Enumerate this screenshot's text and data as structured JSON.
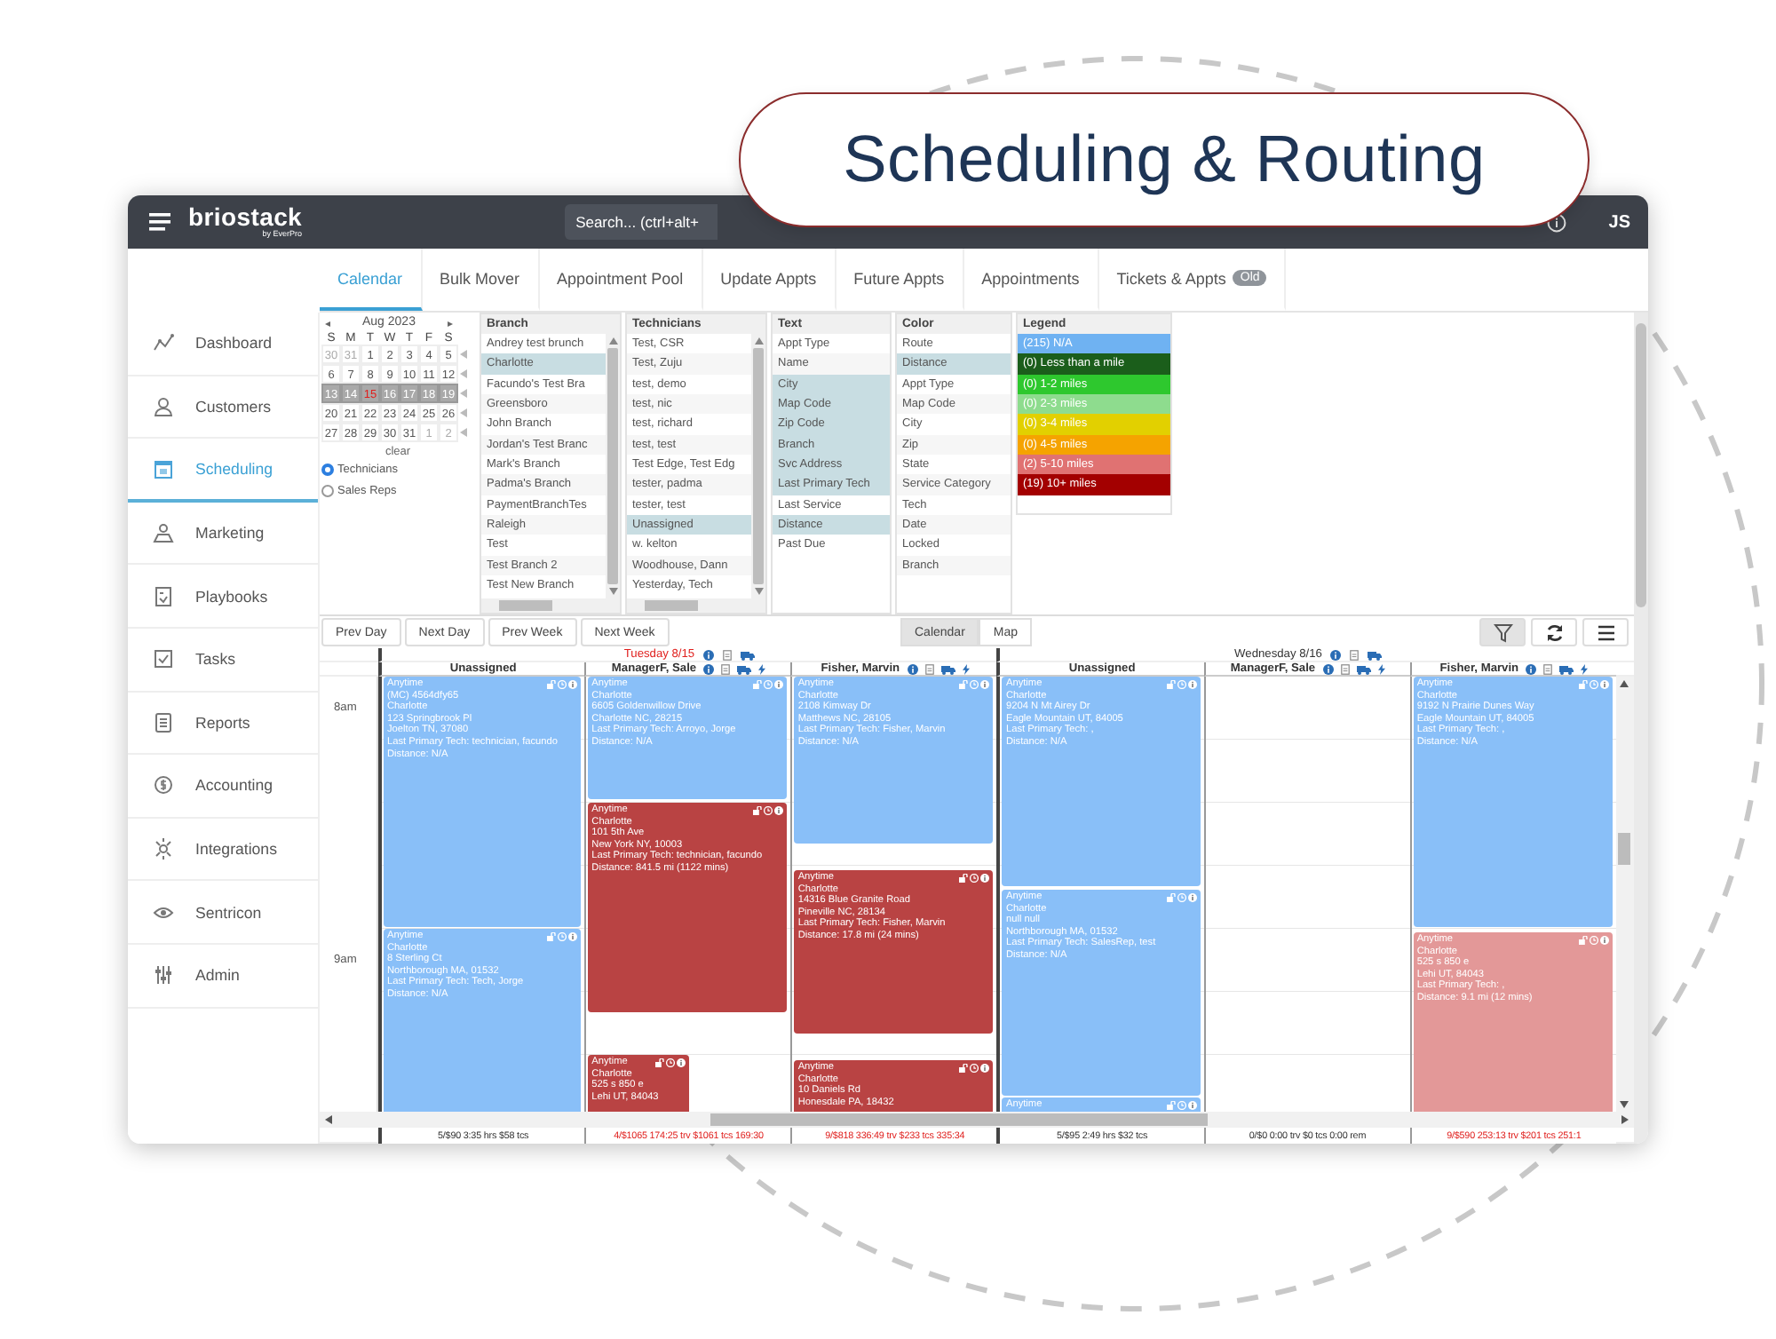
{
  "promo_title": "Scheduling & Routing",
  "header": {
    "logo": "briostack",
    "logo_sub": "by EverPro",
    "search": {
      "placeholder": "Search... (ctrl+alt+"
    },
    "user": "JS"
  },
  "tabs": [
    {
      "label": "Calendar",
      "selected": true
    },
    {
      "label": "Bulk Mover",
      "selected": false
    },
    {
      "label": "Appointment Pool",
      "selected": false
    },
    {
      "label": "Update Appts",
      "selected": false
    },
    {
      "label": "Future Appts",
      "selected": false
    },
    {
      "label": "Appointments",
      "selected": false
    },
    {
      "label": "Tickets & Appts",
      "selected": false,
      "badge": "Old"
    }
  ],
  "sidebar": {
    "items": [
      {
        "label": "Dashboard",
        "selected": false
      },
      {
        "label": "Customers",
        "selected": false
      },
      {
        "label": "Scheduling",
        "selected": true
      },
      {
        "label": "Marketing",
        "selected": false
      },
      {
        "label": "Playbooks",
        "selected": false
      },
      {
        "label": "Tasks",
        "selected": false
      },
      {
        "label": "Reports",
        "selected": false
      },
      {
        "label": "Accounting",
        "selected": false
      },
      {
        "label": "Integrations",
        "selected": false
      },
      {
        "label": "Sentricon",
        "selected": false
      },
      {
        "label": "Admin",
        "selected": false
      }
    ]
  },
  "mini_calendar": {
    "prev": "◂",
    "month": "Aug 2023",
    "next": "▸",
    "weekdays": [
      "S",
      "M",
      "T",
      "W",
      "T",
      "F",
      "S"
    ],
    "clear": "clear",
    "weeks": [
      {
        "selected": false,
        "days": [
          {
            "day": "30",
            "other_month": true,
            "today": false
          },
          {
            "day": "31",
            "other_month": true,
            "today": false
          },
          {
            "day": "1",
            "other_month": false,
            "today": false
          },
          {
            "day": "2",
            "other_month": false,
            "today": false
          },
          {
            "day": "3",
            "other_month": false,
            "today": false
          },
          {
            "day": "4",
            "other_month": false,
            "today": false
          },
          {
            "day": "5",
            "other_month": false,
            "today": false
          }
        ]
      },
      {
        "selected": false,
        "days": [
          {
            "day": "6",
            "other_month": false,
            "today": false
          },
          {
            "day": "7",
            "other_month": false,
            "today": false
          },
          {
            "day": "8",
            "other_month": false,
            "today": false
          },
          {
            "day": "9",
            "other_month": false,
            "today": false
          },
          {
            "day": "10",
            "other_month": false,
            "today": false
          },
          {
            "day": "11",
            "other_month": false,
            "today": false
          },
          {
            "day": "12",
            "other_month": false,
            "today": false
          }
        ]
      },
      {
        "selected": true,
        "days": [
          {
            "day": "13",
            "other_month": false,
            "today": false
          },
          {
            "day": "14",
            "other_month": false,
            "today": false
          },
          {
            "day": "15",
            "other_month": false,
            "today": true
          },
          {
            "day": "16",
            "other_month": false,
            "today": false
          },
          {
            "day": "17",
            "other_month": false,
            "today": false
          },
          {
            "day": "18",
            "other_month": false,
            "today": false
          },
          {
            "day": "19",
            "other_month": false,
            "today": false
          }
        ]
      },
      {
        "selected": false,
        "days": [
          {
            "day": "20",
            "other_month": false,
            "today": false
          },
          {
            "day": "21",
            "other_month": false,
            "today": false
          },
          {
            "day": "22",
            "other_month": false,
            "today": false
          },
          {
            "day": "23",
            "other_month": false,
            "today": false
          },
          {
            "day": "24",
            "other_month": false,
            "today": false
          },
          {
            "day": "25",
            "other_month": false,
            "today": false
          },
          {
            "day": "26",
            "other_month": false,
            "today": false
          }
        ]
      },
      {
        "selected": false,
        "days": [
          {
            "day": "27",
            "other_month": false,
            "today": false
          },
          {
            "day": "28",
            "other_month": false,
            "today": false
          },
          {
            "day": "29",
            "other_month": false,
            "today": false
          },
          {
            "day": "30",
            "other_month": false,
            "today": false
          },
          {
            "day": "31",
            "other_month": false,
            "today": false
          },
          {
            "day": "1",
            "other_month": true,
            "today": false
          },
          {
            "day": "2",
            "other_month": true,
            "today": false
          }
        ]
      }
    ]
  },
  "view_radios": [
    {
      "label": "Technicians",
      "selected": true
    },
    {
      "label": "Sales Reps",
      "selected": false
    }
  ],
  "filters": [
    {
      "title": "Branch",
      "kind": "scrolling",
      "items": [
        {
          "label": "Andrey test brunch",
          "selected": false
        },
        {
          "label": "Charlotte",
          "selected": true
        },
        {
          "label": "Facundo's Test Bra",
          "selected": false
        },
        {
          "label": "Greensboro",
          "selected": false
        },
        {
          "label": "John Branch",
          "selected": false
        },
        {
          "label": "Jordan's Test Branc",
          "selected": false
        },
        {
          "label": "Mark's Branch",
          "selected": false
        },
        {
          "label": "Padma's Branch",
          "selected": false
        },
        {
          "label": "PaymentBranchTes",
          "selected": false
        },
        {
          "label": "Raleigh",
          "selected": false
        },
        {
          "label": "Test",
          "selected": false
        },
        {
          "label": "Test Branch 2",
          "selected": false
        },
        {
          "label": "Test New Branch",
          "selected": false
        }
      ]
    },
    {
      "title": "Technicians",
      "kind": "scrolling",
      "items": [
        {
          "label": "Test, CSR",
          "selected": false
        },
        {
          "label": "Test, Zuju",
          "selected": false
        },
        {
          "label": "test, demo",
          "selected": false
        },
        {
          "label": "test, nic",
          "selected": false
        },
        {
          "label": "test, richard",
          "selected": false
        },
        {
          "label": "test, test",
          "selected": false
        },
        {
          "label": "Test Edge, Test Edg",
          "selected": false
        },
        {
          "label": "tester, padma",
          "selected": false
        },
        {
          "label": "tester, test",
          "selected": false
        },
        {
          "label": "Unassigned",
          "selected": true
        },
        {
          "label": "w. kelton",
          "selected": false
        },
        {
          "label": "Woodhouse, Dann",
          "selected": false
        },
        {
          "label": "Yesterday, Tech",
          "selected": false
        }
      ]
    },
    {
      "title": "Text",
      "kind": "plain",
      "items": [
        {
          "label": "Appt Type",
          "selected": false
        },
        {
          "label": "Name",
          "selected": false
        },
        {
          "label": "City",
          "selected": true
        },
        {
          "label": "Map Code",
          "selected": true
        },
        {
          "label": "Zip Code",
          "selected": true
        },
        {
          "label": "Branch",
          "selected": true
        },
        {
          "label": "Svc Address",
          "selected": true
        },
        {
          "label": "Last Primary Tech",
          "selected": true
        },
        {
          "label": "Last Service",
          "selected": false
        },
        {
          "label": "Distance",
          "selected": true
        },
        {
          "label": "Past Due",
          "selected": false
        }
      ]
    },
    {
      "title": "Color",
      "kind": "plain",
      "items": [
        {
          "label": "Route",
          "selected": false
        },
        {
          "label": "Distance",
          "selected": true
        },
        {
          "label": "Appt Type",
          "selected": false
        },
        {
          "label": "Map Code",
          "selected": false
        },
        {
          "label": "City",
          "selected": false
        },
        {
          "label": "Zip",
          "selected": false
        },
        {
          "label": "State",
          "selected": false
        },
        {
          "label": "Service Category",
          "selected": false
        },
        {
          "label": "Tech",
          "selected": false
        },
        {
          "label": "Date",
          "selected": false
        },
        {
          "label": "Locked",
          "selected": false
        },
        {
          "label": "Branch",
          "selected": false
        }
      ]
    }
  ],
  "legend": {
    "title": "Legend",
    "items": [
      {
        "label": "(215) N/A",
        "color": "#6fb2f2"
      },
      {
        "label": "(0) Less than a mile",
        "color": "#1b5e1b"
      },
      {
        "label": "(0) 1-2 miles",
        "color": "#2ec82e"
      },
      {
        "label": "(0) 2-3 miles",
        "color": "#8edc8e"
      },
      {
        "label": "(0) 3-4 miles",
        "color": "#e2d000"
      },
      {
        "label": "(0) 4-5 miles",
        "color": "#f5a300"
      },
      {
        "label": "(2) 5-10 miles",
        "color": "#e07272"
      },
      {
        "label": "(19) 10+ miles",
        "color": "#a30000"
      }
    ]
  },
  "toolbar": {
    "nav": [
      "Prev Day",
      "Next Day",
      "Prev Week",
      "Next Week"
    ],
    "views": [
      {
        "label": "Calendar",
        "selected": true
      },
      {
        "label": "Map",
        "selected": false
      }
    ]
  },
  "calendar": {
    "times": [
      "8am",
      "9am"
    ],
    "days": [
      {
        "title": "Tuesday 8/15",
        "today": true,
        "columns": [
          {
            "name": "Unassigned",
            "kind": "pool",
            "summary": "5/$90 3:35 hrs $58 tcs",
            "over": false,
            "appointments": [
              {
                "color": "#89bff8",
                "overlap": false,
                "lines": [
                  "Anytime",
                  "(MC) 4564dfy65",
                  "Charlotte",
                  "123 Springbrook Pl",
                  "Joelton TN, 37080",
                  "Last Primary Tech: technician, facundo",
                  "Distance: N/A"
                ]
              },
              {
                "color": "#89bff8",
                "overlap": false,
                "lines": [
                  "Anytime",
                  "Charlotte",
                  "8 Sterling Ct",
                  "Northborough MA, 01532",
                  "Last Primary Tech: Tech, Jorge",
                  "Distance: N/A"
                ]
              }
            ]
          },
          {
            "name": "ManagerF, Sale",
            "kind": "tech",
            "summary": "4/$1065 174:25 trv $1061 tcs 169:30",
            "over": true,
            "appointments": [
              {
                "color": "#89bff8",
                "overlap": false,
                "lines": [
                  "Anytime",
                  "Charlotte",
                  "6605 Goldenwillow Drive",
                  "Charlotte NC, 28215",
                  "Last Primary Tech: Arroyo, Jorge",
                  "Distance: N/A"
                ]
              },
              {
                "color": "#b94343",
                "overlap": false,
                "lines": [
                  "Anytime",
                  "Charlotte",
                  "101 5th Ave",
                  "New York NY, 10003",
                  "Last Primary Tech: technician, facundo",
                  "Distance: 841.5 mi (1122 mins)"
                ]
              },
              {
                "color": "#b94343",
                "overlap": true,
                "lines": [
                  "Anytime",
                  "Charlotte",
                  "525 s 850 e",
                  "Lehi UT, 84043"
                ]
              }
            ]
          },
          {
            "name": "Fisher, Marvin",
            "kind": "tech",
            "summary": "9/$818 336:49 trv $233 tcs 335:34",
            "over": true,
            "appointments": [
              {
                "color": "#89bff8",
                "overlap": false,
                "lines": [
                  "Anytime",
                  "Charlotte",
                  "2108 Kimway Dr",
                  "Matthews NC, 28105",
                  "Last Primary Tech: Fisher, Marvin",
                  "Distance: N/A"
                ]
              },
              {
                "color": "#b94343",
                "overlap": false,
                "lines": [
                  "Anytime",
                  "Charlotte",
                  "14316 Blue Granite Road",
                  "Pineville NC, 28134",
                  "Last Primary Tech: Fisher, Marvin",
                  "Distance: 17.8 mi (24 mins)"
                ]
              },
              {
                "color": "#b94343",
                "overlap": false,
                "lines": [
                  "Anytime",
                  "Charlotte",
                  "10 Daniels Rd",
                  "Honesdale PA, 18432"
                ]
              }
            ]
          }
        ]
      },
      {
        "title": "Wednesday 8/16",
        "today": false,
        "columns": [
          {
            "name": "Unassigned",
            "kind": "pool",
            "summary": "5/$95 2:49 hrs $32 tcs",
            "over": false,
            "appointments": [
              {
                "color": "#89bff8",
                "overlap": false,
                "lines": [
                  "Anytime",
                  "Charlotte",
                  "9204 N Mt Airey Dr",
                  "Eagle Mountain UT, 84005",
                  "Last Primary Tech: ,",
                  "Distance: N/A"
                ]
              },
              {
                "color": "#89bff8",
                "overlap": false,
                "lines": [
                  "Anytime",
                  "Charlotte",
                  "null null",
                  "Northborough MA, 01532",
                  "Last Primary Tech: SalesRep, test",
                  "Distance: N/A"
                ]
              },
              {
                "color": "#89bff8",
                "overlap": false,
                "lines": [
                  "Anytime"
                ]
              }
            ]
          },
          {
            "name": "ManagerF, Sale",
            "kind": "tech",
            "summary": "0/$0 0:00 trv $0 tcs 0:00 rem",
            "over": false
          },
          {
            "name": "Fisher, Marvin",
            "kind": "tech",
            "summary": "9/$590 253:13 trv $201 tcs 251:1",
            "over": true,
            "appointments": [
              {
                "color": "#89bff8",
                "overlap": false,
                "lines": [
                  "Anytime",
                  "Charlotte",
                  "9192 N Prairie Dunes Way",
                  "Eagle Mountain UT, 84005",
                  "Last Primary Tech: ,",
                  "Distance: N/A"
                ]
              },
              {
                "color": "#e39898",
                "overlap": false,
                "lines": [
                  "Anytime",
                  "Charlotte",
                  "525 s 850 e",
                  "Lehi UT, 84043",
                  "Last Primary Tech: ,",
                  "Distance: 9.1 mi (12 mins)"
                ]
              }
            ]
          }
        ]
      }
    ]
  }
}
